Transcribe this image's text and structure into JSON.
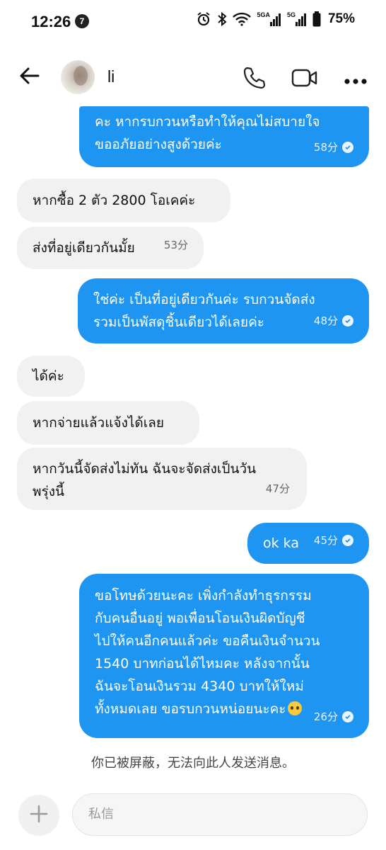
{
  "status_bar": {
    "time": "12:26",
    "notification_badge": "7",
    "network_1": "5GA",
    "network_2": "5G",
    "battery": "75%"
  },
  "header": {
    "contact_name": "li",
    "icons": [
      "back-arrow-icon",
      "avatar",
      "phone-icon",
      "video-camera-icon",
      "more-icon"
    ]
  },
  "messages": [
    {
      "side": "sent",
      "lines": "คะ หากรบกวนหรือทำให้คุณไม่สบายใจ\nขออภัยอย่างสูงด้วยค่ะ",
      "time": "58分",
      "read": true
    },
    {
      "side": "received",
      "lines": "หากซื้อ 2 ตัว 2800 โอเคค่ะ",
      "time": ""
    },
    {
      "side": "received",
      "lines": "ส่งที่อยู่เดียวกันมั้ย",
      "time": "53分"
    },
    {
      "side": "sent",
      "lines": "ใช่ค่ะ เป็นที่อยู่เดียวกันค่ะ รบกวนจัดส่ง\nรวมเป็นพัสดุชิ้นเดียวได้เลยค่ะ",
      "time": "48分",
      "read": true
    },
    {
      "side": "received",
      "lines": "ได้ค่ะ",
      "time": ""
    },
    {
      "side": "received",
      "lines": "หากจ่ายแล้วแจ้งได้เลย",
      "time": ""
    },
    {
      "side": "received",
      "lines": "หากวันนี้จัดส่งไม่ทัน ฉันจะจัดส่งเป็นวัน\nพรุ่งนี้",
      "time": "47分"
    },
    {
      "side": "sent",
      "lines": "ok ka",
      "time": "45分",
      "read": true
    },
    {
      "side": "sent",
      "lines": "ขอโทษด้วยนะคะ เพิ่งกำลังทำธุรกรรม\nกับคนอื่นอยู่ พอเพื่อนโอนเงินผิดบัญชี\nไปให้คนอีกคนแล้วค่ะ ขอคืนเงินจำนวน\n1540 บาทก่อนได้ไหมคะ หลังจากนั้น\nฉันจะโอนเงินรวม 4340 บาทให้ใหม่\nทั้งหมดเลย ขอรบกวนหน่อยนะคะ",
      "time": "26分",
      "read": true,
      "emoji": "pleading-face-emoji"
    }
  ],
  "blocked_notice": "你已被屏蔽，无法向此人发送消息。",
  "composer": {
    "placeholder": "私信"
  },
  "colors": {
    "sent_bubble": "#1f95f2",
    "received_bubble": "#f1f1f2"
  }
}
